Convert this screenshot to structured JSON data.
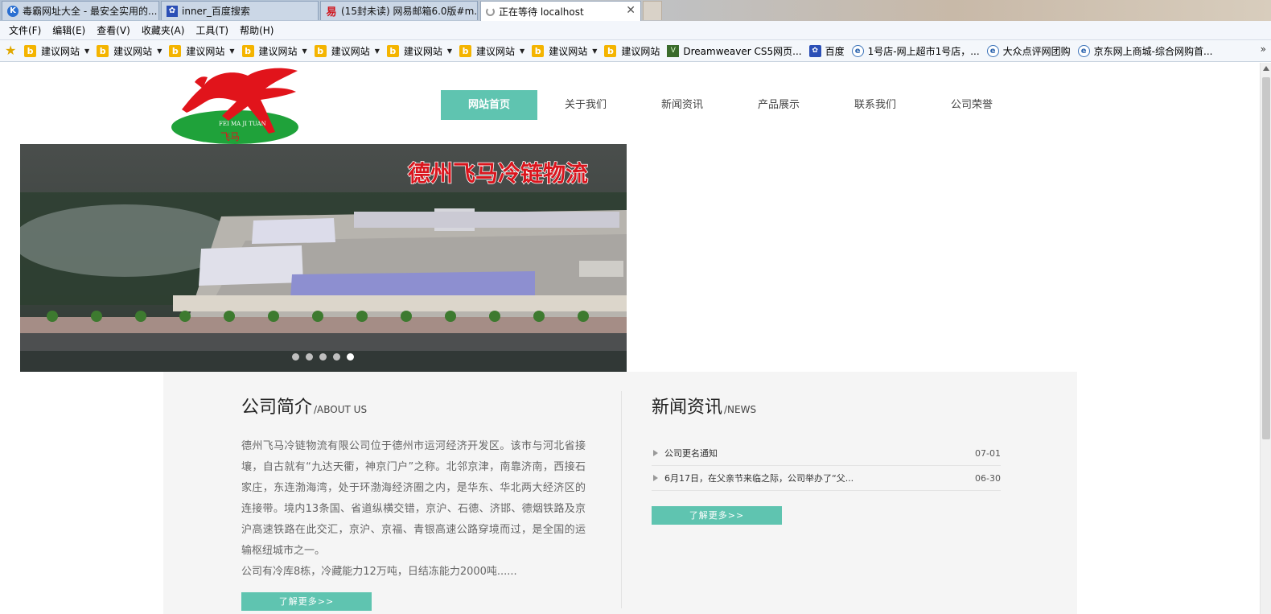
{
  "tabs": [
    {
      "label": "毒霸网址大全 - 最安全实用的...",
      "icon": "k-browser-icon"
    },
    {
      "label": "inner_百度搜索",
      "icon": "baidu-paw-icon"
    },
    {
      "label": "(15封未读) 网易邮箱6.0版#m...",
      "icon": "netease-mail-icon"
    },
    {
      "label": "正在等待 localhost",
      "icon": "loading-icon",
      "close": "✕"
    }
  ],
  "menu": [
    "文件(F)",
    "编辑(E)",
    "查看(V)",
    "收藏夹(A)",
    "工具(T)",
    "帮助(H)"
  ],
  "favorites": {
    "suggested": [
      "建议网站",
      "建议网站",
      "建议网站",
      "建议网站",
      "建议网站",
      "建议网站",
      "建议网站",
      "建议网站",
      "建议网站"
    ],
    "others": [
      "Dreamweaver CS5网页...",
      "百度",
      "1号店-网上超市1号店，...",
      "大众点评网团购",
      "京东网上商城-综合网购首..."
    ]
  },
  "site": {
    "logo": {
      "text": "FEI MA JI TUAN",
      "mark": "飞马"
    },
    "nav": [
      "网站首页",
      "关于我们",
      "新闻资讯",
      "产品展示",
      "联系我们",
      "公司荣誉"
    ],
    "banner": {
      "headline": "德州飞马冷链物流",
      "slides": 5,
      "active_slide": 5
    },
    "about": {
      "title": "公司简介",
      "subtitle": "/ABOUT US",
      "text": "德州飞马冷链物流有限公司位于德州市运河经济开发区。该市与河北省接壤，自古就有“九达天衢，神京门户”之称。北邻京津，南靠济南，西接石家庄，东连渤海湾，处于环渤海经济圈之内，是华东、华北两大经济区的连接带。境内13条国、省道纵横交错，京沪、石德、济邯、德烟铁路及京沪高速铁路在此交汇，京沪、京福、青银高速公路穿境而过，是全国的运输枢纽城市之一。",
      "text2": "公司有冷库8栋，冷藏能力12万吨，日结冻能力2000吨......",
      "more": "了解更多>>"
    },
    "news": {
      "title": "新闻资讯",
      "subtitle": "/NEWS",
      "items": [
        {
          "title": "公司更名通知",
          "date": "07-01"
        },
        {
          "title": "6月17日，在父亲节来临之际，公司举办了“父...",
          "date": "06-30"
        }
      ],
      "more": "了解更多>>"
    }
  },
  "colors": {
    "accent": "#5fc4b0",
    "logo_red": "#e1141b",
    "logo_green": "#1fa23a"
  }
}
